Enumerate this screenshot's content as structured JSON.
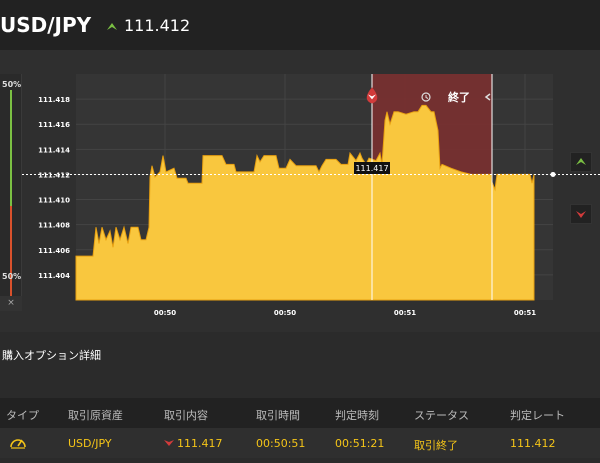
{
  "header": {
    "pair": "USD/JPY",
    "price": "111.412",
    "arrow_color": "#7bc043"
  },
  "sentiment": {
    "top_pct": "50%",
    "bottom_pct": "50%",
    "close_label": "×"
  },
  "chart_data": {
    "type": "area",
    "title": "",
    "xlabel": "",
    "ylabel": "",
    "ylim": [
      111.402,
      111.42
    ],
    "y_ticks": [
      "111.418",
      "111.416",
      "111.414",
      "111.412",
      "111.410",
      "111.408",
      "111.406",
      "111.404"
    ],
    "x_ticks": [
      "00:50",
      "00:50",
      "00:51",
      "00:51"
    ],
    "current_rate": 111.412,
    "entry_label": "111.417",
    "expired_label": "終了",
    "series": [
      {
        "values": [
          [
            0,
            111.4055
          ],
          [
            17,
            111.4055
          ],
          [
            20,
            111.4078
          ],
          [
            23,
            111.4065
          ],
          [
            26,
            111.4078
          ],
          [
            30,
            111.4068
          ],
          [
            34,
            111.4075
          ],
          [
            37,
            111.4062
          ],
          [
            40,
            111.4078
          ],
          [
            44,
            111.4068
          ],
          [
            48,
            111.4078
          ],
          [
            52,
            111.4065
          ],
          [
            55,
            111.4078
          ],
          [
            62,
            111.4078
          ],
          [
            65,
            111.4068
          ],
          [
            70,
            111.4068
          ],
          [
            73,
            111.4078
          ],
          [
            74,
            111.4118
          ],
          [
            76,
            111.4127
          ],
          [
            79,
            111.4118
          ],
          [
            84,
            111.4122
          ],
          [
            87,
            111.4135
          ],
          [
            90,
            111.4122
          ],
          [
            98,
            111.4125
          ],
          [
            101,
            111.4117
          ],
          [
            110,
            111.4117
          ],
          [
            112,
            111.4113
          ],
          [
            126,
            111.4113
          ],
          [
            127,
            111.4135
          ],
          [
            146,
            111.4135
          ],
          [
            150,
            111.4128
          ],
          [
            158,
            111.4128
          ],
          [
            160,
            111.4122
          ],
          [
            178,
            111.4122
          ],
          [
            181,
            111.4135
          ],
          [
            184,
            111.413
          ],
          [
            188,
            111.4135
          ],
          [
            200,
            111.4135
          ],
          [
            203,
            111.4125
          ],
          [
            210,
            111.4125
          ],
          [
            214,
            111.4132
          ],
          [
            220,
            111.4127
          ],
          [
            240,
            111.4127
          ],
          [
            243,
            111.4122
          ],
          [
            246,
            111.4127
          ],
          [
            250,
            111.4132
          ],
          [
            260,
            111.4132
          ],
          [
            265,
            111.4128
          ],
          [
            272,
            111.4128
          ],
          [
            274,
            111.4137
          ],
          [
            280,
            111.4131
          ],
          [
            284,
            111.4137
          ],
          [
            286,
            111.4133
          ],
          [
            290,
            111.4128
          ],
          [
            293,
            111.4133
          ],
          [
            300,
            111.4131
          ],
          [
            304,
            111.4137
          ],
          [
            306,
            111.4128
          ],
          [
            309,
            111.4163
          ],
          [
            311,
            111.417
          ],
          [
            314,
            111.416
          ],
          [
            318,
            111.417
          ],
          [
            322,
            111.417
          ],
          [
            330,
            111.4168
          ],
          [
            338,
            111.417
          ],
          [
            342,
            111.417
          ],
          [
            346,
            111.4175
          ],
          [
            350,
            111.4175
          ],
          [
            355,
            111.417
          ],
          [
            358,
            111.417
          ],
          [
            362,
            111.4155
          ],
          [
            364,
            111.4125
          ],
          [
            366,
            111.4128
          ],
          [
            375,
            111.4125
          ],
          [
            385,
            111.4122
          ],
          [
            395,
            111.412
          ],
          [
            405,
            111.412
          ],
          [
            415,
            111.412
          ],
          [
            416,
            111.4114
          ],
          [
            419,
            111.4108
          ],
          [
            421,
            111.412
          ],
          [
            430,
            111.412
          ],
          [
            440,
            111.412
          ],
          [
            454,
            111.412
          ],
          [
            456,
            111.4113
          ],
          [
            458,
            111.412
          ]
        ]
      }
    ],
    "colors": {
      "area": "#f9c73e",
      "area_top": "#e8a010",
      "expired_region": "#7a3030",
      "marker_up": "#7bc043",
      "marker_down": "#d23b3b"
    }
  },
  "details": {
    "title": "購入オプション詳細",
    "columns": [
      "タイプ",
      "取引原資産",
      "取引内容",
      "取引時間",
      "判定時刻",
      "ステータス",
      "判定レート"
    ],
    "row": {
      "asset": "USD/JPY",
      "content": "111.417",
      "trade_time": "00:50:51",
      "judge_time": "00:51:21",
      "status": "取引終了",
      "rate": "111.412"
    }
  }
}
